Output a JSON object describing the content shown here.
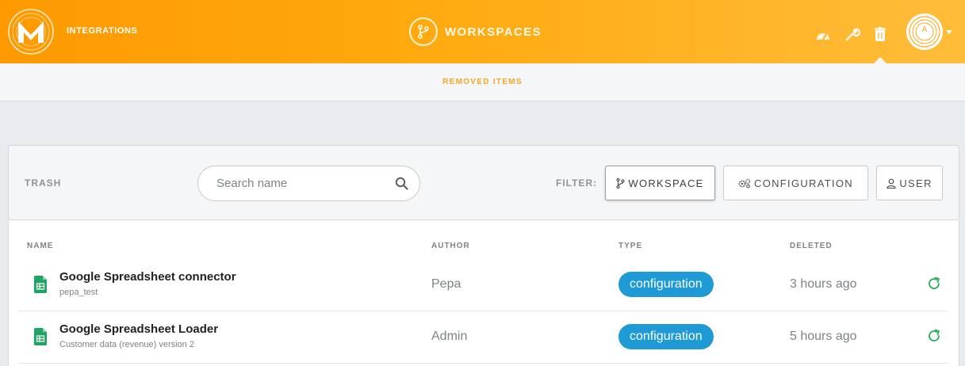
{
  "header": {
    "nav_integrations": "INTEGRATIONS",
    "workspaces_label": "WORKSPACES",
    "avatar_initial": "A",
    "accent_color": "#fd9a00"
  },
  "subheader": {
    "title": "REMOVED ITEMS"
  },
  "toolbar": {
    "trash_label": "TRASH",
    "search_placeholder": "Search name",
    "filter_label": "FILTER:",
    "filters": [
      {
        "label": "WORKSPACE",
        "icon": "branch-icon",
        "active": true
      },
      {
        "label": "CONFIGURATION",
        "icon": "gears-icon",
        "active": false
      },
      {
        "label": "USER",
        "icon": "user-icon",
        "active": false
      }
    ]
  },
  "table": {
    "columns": [
      "NAME",
      "AUTHOR",
      "TYPE",
      "DELETED"
    ],
    "rows": [
      {
        "title": "Google Spreadsheet connector",
        "subtitle": "pepa_test",
        "author": "Pepa",
        "type": "configuration",
        "deleted": "3 hours ago",
        "icon": "spreadsheet-icon"
      },
      {
        "title": "Google Spreadsheet Loader",
        "subtitle": "Customer data (revenue) version 2",
        "author": "Admin",
        "type": "configuration",
        "deleted": "5 hours ago",
        "icon": "spreadsheet-icon"
      }
    ],
    "type_color": "#1e9ad6",
    "restore_color": "#27ae60"
  }
}
